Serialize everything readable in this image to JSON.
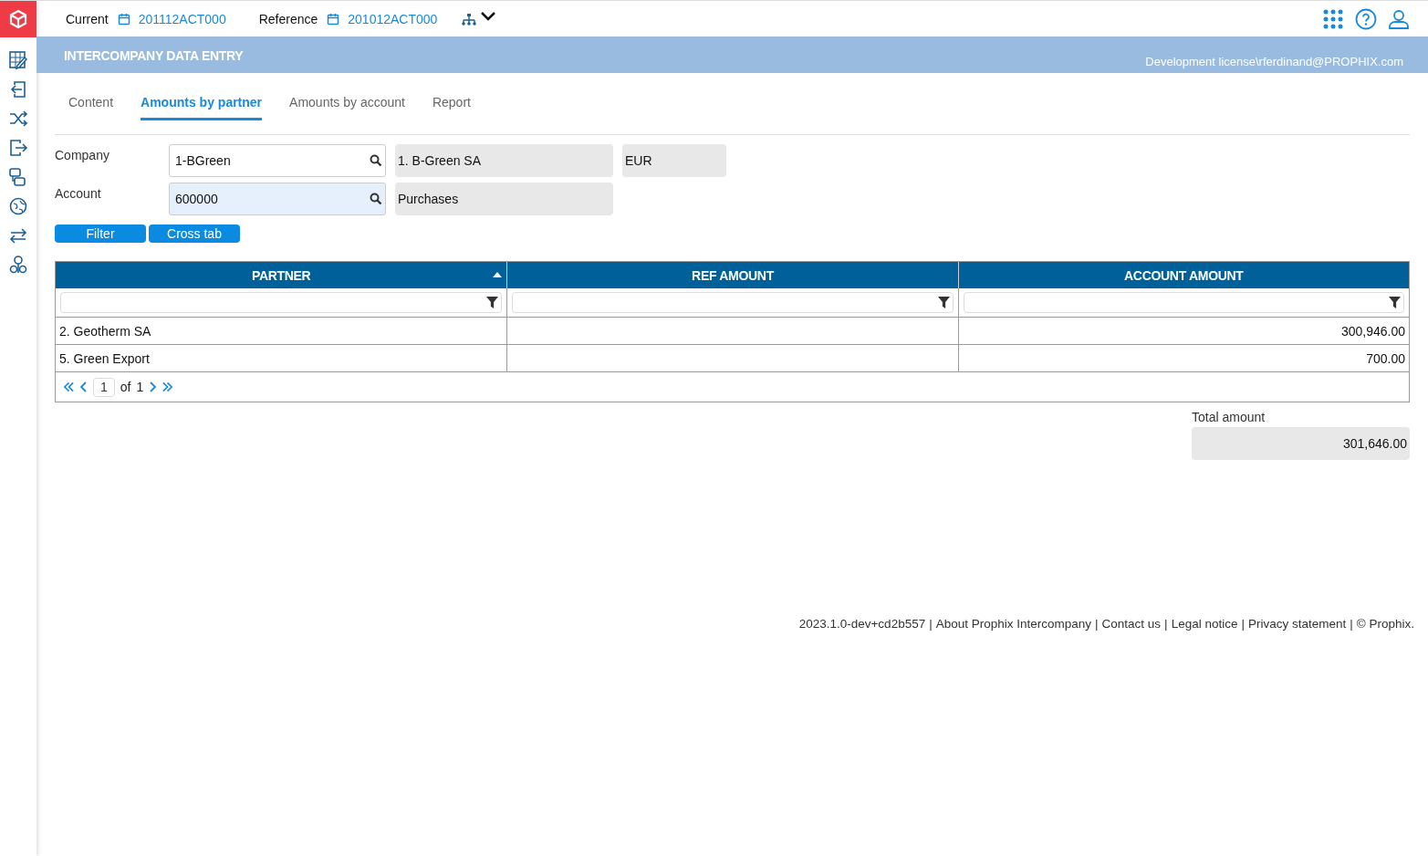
{
  "top_bar": {
    "current_label": "Current",
    "current_value": "201112ACT000",
    "reference_label": "Reference",
    "reference_value": "201012ACT000"
  },
  "header": {
    "title": "INTERCOMPANY DATA ENTRY",
    "license": "Development license\\rferdinand@PROPHIX.com"
  },
  "tabs": [
    {
      "label": "Content",
      "selected": false
    },
    {
      "label": "Amounts by partner",
      "selected": true
    },
    {
      "label": "Amounts by account",
      "selected": false
    },
    {
      "label": "Report",
      "selected": false
    }
  ],
  "form": [
    {
      "label": "Company",
      "value": "1-BGreen",
      "focused": false,
      "description": "1. B-Green SA",
      "currency": "EUR"
    },
    {
      "label": "Account",
      "value": "600000",
      "focused": true,
      "description": "Purchases"
    }
  ],
  "buttons": [
    "Filter",
    "Cross tab"
  ],
  "table": {
    "columns": [
      {
        "label": "PARTNER",
        "sorted": true
      },
      {
        "label": "REF AMOUNT",
        "sorted": false
      },
      {
        "label": "ACCOUNT AMOUNT",
        "sorted": false
      }
    ],
    "rows": [
      [
        "2. Geotherm SA",
        "",
        "300,946.00"
      ],
      [
        "5. Green Export",
        "",
        "700.00"
      ]
    ],
    "pager": {
      "page": "1",
      "of_label": "of",
      "total": "1"
    }
  },
  "total": {
    "label": "Total amount",
    "value": "301,646.00"
  },
  "footer": {
    "version": "2023.1.0-dev+cd2b557",
    "separator": "|",
    "links": [
      "About Prophix Intercompany",
      "Contact us",
      "Legal notice",
      "Privacy statement"
    ],
    "copyright": "© Prophix."
  }
}
